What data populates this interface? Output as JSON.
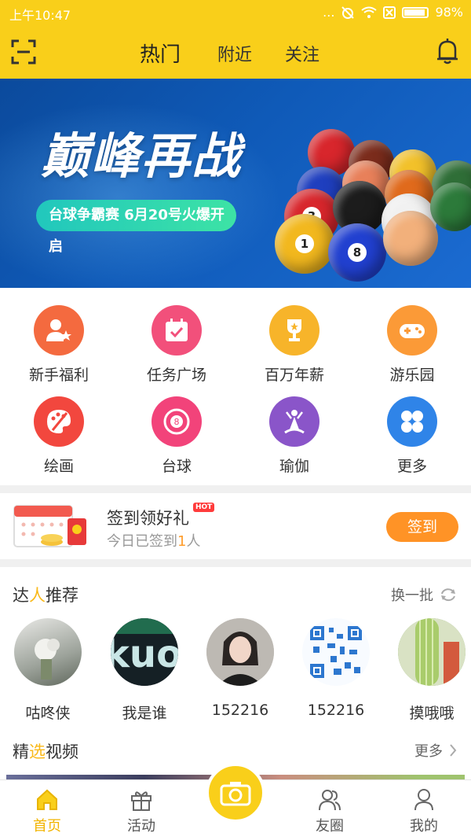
{
  "status": {
    "time": "上午10:47",
    "dots": "...",
    "battery": "98%"
  },
  "header": {
    "tabs": [
      {
        "label": "热门"
      },
      {
        "label": "附近"
      },
      {
        "label": "关注"
      }
    ]
  },
  "banner": {
    "title": "巅峰再战",
    "subtitle": "台球争霸赛 6月20号火爆开启",
    "balls": [
      "3",
      "1",
      "8"
    ]
  },
  "categories": [
    {
      "label": "新手福利",
      "icon": "user-star-icon",
      "color": "#f46a3f"
    },
    {
      "label": "任务广场",
      "icon": "calendar-check-icon",
      "color": "#f2507b"
    },
    {
      "label": "百万年薪",
      "icon": "trophy-icon",
      "color": "#f7b42a"
    },
    {
      "label": "游乐园",
      "icon": "gamepad-icon",
      "color": "#fb9a37"
    },
    {
      "label": "绘画",
      "icon": "palette-icon",
      "color": "#f2473e"
    },
    {
      "label": "台球",
      "icon": "billiard-ball-icon",
      "color": "#f2437a"
    },
    {
      "label": "瑜伽",
      "icon": "yoga-icon",
      "color": "#8a55c9"
    },
    {
      "label": "更多",
      "icon": "grid-icon",
      "color": "#2f84e8"
    }
  ],
  "signin": {
    "title": "签到领好礼",
    "hot": "HOT",
    "sub_prefix": "今日已签到",
    "count": "1",
    "sub_suffix": "人",
    "button": "签到"
  },
  "experts": {
    "title_a": "达",
    "title_hl": "人",
    "title_b": "推荐",
    "refresh": "换一批",
    "people": [
      {
        "name": "咕咚侠"
      },
      {
        "name": "我是谁"
      },
      {
        "name": "152216"
      },
      {
        "name": "152216"
      },
      {
        "name": "摸哦哦"
      }
    ]
  },
  "videos": {
    "title_a": "精",
    "title_hl": "选",
    "title_b": "视频",
    "more": "更多"
  },
  "bottom_nav": [
    {
      "label": "首页"
    },
    {
      "label": "活动"
    },
    {
      "label": "友圈"
    },
    {
      "label": "我的"
    }
  ],
  "colors": {
    "brand": "#f9cf1a",
    "accent": "#ff9326"
  }
}
